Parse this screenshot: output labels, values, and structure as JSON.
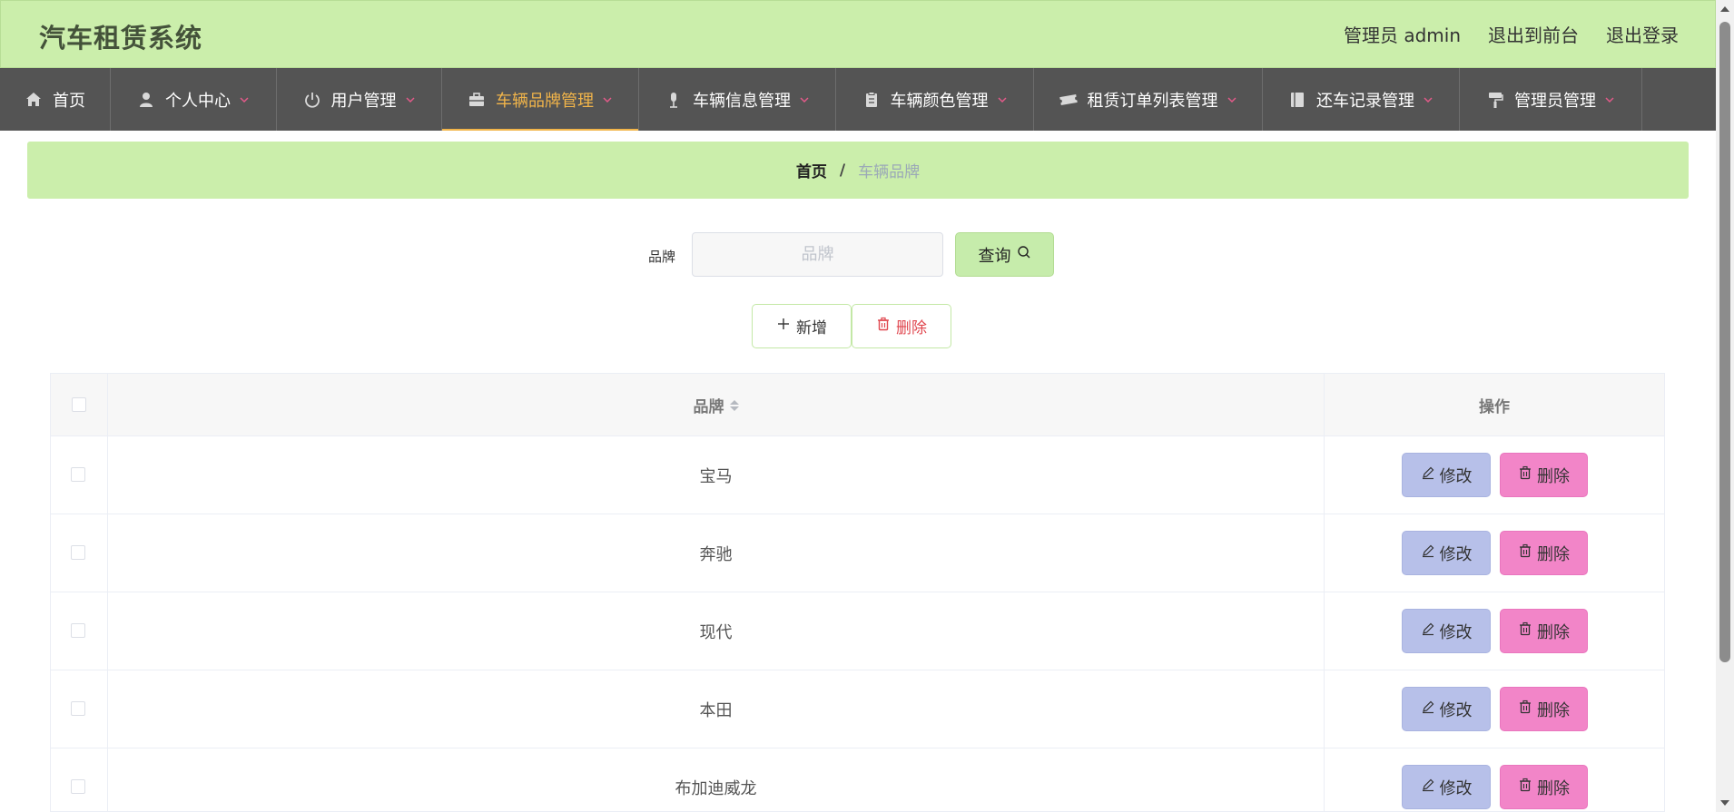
{
  "header": {
    "title": "汽车租赁系统",
    "admin_label": "管理员 admin",
    "back_frontend": "退出到前台",
    "logout": "退出登录"
  },
  "nav": {
    "items": [
      {
        "label": "首页",
        "icon": "home-icon",
        "dropdown": false
      },
      {
        "label": "个人中心",
        "icon": "user-icon",
        "dropdown": true
      },
      {
        "label": "用户管理",
        "icon": "power-icon",
        "dropdown": true
      },
      {
        "label": "车辆品牌管理",
        "icon": "briefcase-icon",
        "dropdown": true,
        "active": true
      },
      {
        "label": "车辆信息管理",
        "icon": "microphone-icon",
        "dropdown": true
      },
      {
        "label": "车辆颜色管理",
        "icon": "clipboard-icon",
        "dropdown": true
      },
      {
        "label": "租赁订单列表管理",
        "icon": "ticket-icon",
        "dropdown": true
      },
      {
        "label": "还车记录管理",
        "icon": "book-icon",
        "dropdown": true
      },
      {
        "label": "管理员管理",
        "icon": "paint-roller-icon",
        "dropdown": true
      }
    ]
  },
  "breadcrumb": {
    "home": "首页",
    "separator": "/",
    "current": "车辆品牌"
  },
  "search": {
    "label": "品牌",
    "placeholder": "品牌",
    "value": "",
    "button": "查询"
  },
  "actions": {
    "add": "新增",
    "delete": "删除"
  },
  "table": {
    "headers": {
      "brand": "品牌",
      "ops": "操作"
    },
    "rows": [
      {
        "brand": "宝马"
      },
      {
        "brand": "奔驰"
      },
      {
        "brand": "现代"
      },
      {
        "brand": "本田"
      },
      {
        "brand": "布加迪威龙"
      }
    ],
    "edit_label": "修改",
    "delete_label": "删除"
  },
  "colors": {
    "header_bg": "#cbeeab",
    "nav_bg": "#545454",
    "active_nav": "#f2b54a",
    "edit_btn": "#b7c0e9",
    "delete_btn": "#f285c8",
    "delete_text": "#e0474f"
  }
}
